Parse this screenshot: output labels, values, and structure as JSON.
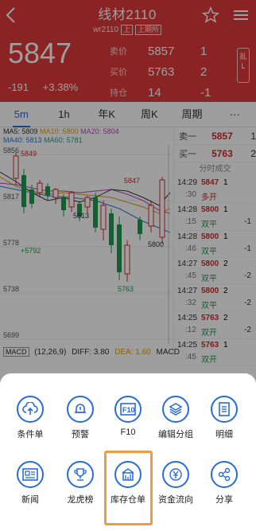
{
  "header": {
    "title": "线材2110",
    "code": "wr2110",
    "tag1": "上",
    "tag2": "上期所",
    "price": "5847",
    "change": "-191",
    "change_pct": "+3.38%",
    "quote": [
      {
        "label": "卖价",
        "value": "5857",
        "num": "1"
      },
      {
        "label": "买价",
        "value": "5763",
        "num": "2"
      },
      {
        "label": "持仓",
        "value": "14",
        "num": "-1"
      }
    ],
    "side_btn": "乱 L"
  },
  "tabs": [
    {
      "label": "5m",
      "active": true
    },
    {
      "label": "1h",
      "active": false
    },
    {
      "label": "年K",
      "active": false
    },
    {
      "label": "周K",
      "active": false
    },
    {
      "label": "周期",
      "active": false
    },
    {
      "label": "···",
      "active": false
    }
  ],
  "chart": {
    "ma_line1": {
      "ma5": "MA5: 5809",
      "ma10": "MA10: 5800",
      "ma20": "MA20: 5804"
    },
    "ma_line2": {
      "ma40": "MA40: 5813",
      "ma60": "MA60: 5781"
    },
    "y_labels": [
      "5856",
      "5817",
      "5778",
      "5738",
      "5699"
    ],
    "annotations": [
      "5849",
      "5813",
      "+5792",
      "5847",
      "5800",
      "5763"
    ]
  },
  "orderbook": {
    "ask_label": "卖一",
    "ask_price": "5857",
    "ask_num": "1",
    "bid_label": "买一",
    "bid_price": "5763",
    "bid_num": "2",
    "ticks_title": "分时成交",
    "ticks": [
      {
        "time": "14:29",
        "sec": ":30",
        "price": "5847",
        "action": "多开",
        "vol": "1",
        "delta": "",
        "pc": "red",
        "ac": "red"
      },
      {
        "time": "14:28",
        "sec": ":15",
        "price": "5800",
        "action": "双平",
        "vol": "1",
        "delta": "-1",
        "pc": "red",
        "ac": "green"
      },
      {
        "time": "14:28",
        "sec": ":46",
        "price": "5800",
        "action": "双平",
        "vol": "1",
        "delta": "-1",
        "pc": "red",
        "ac": "green"
      },
      {
        "time": "14:27",
        "sec": ":45",
        "price": "5800",
        "action": "双平",
        "vol": "2",
        "delta": "-2",
        "pc": "red",
        "ac": "green"
      },
      {
        "time": "14:27",
        "sec": ":32",
        "price": "5800",
        "action": "双平",
        "vol": "2",
        "delta": "-2",
        "pc": "red",
        "ac": "green"
      },
      {
        "time": "14:25",
        "sec": ":12",
        "price": "5763",
        "action": "双开",
        "vol": "2",
        "delta": "-2",
        "pc": "red",
        "ac": "green"
      },
      {
        "time": "14:25",
        "sec": ":45",
        "price": "5763",
        "action": "双开",
        "vol": "1",
        "delta": "",
        "pc": "red",
        "ac": "green"
      }
    ]
  },
  "macd": {
    "key": "MACD",
    "params": "(12,26,9)",
    "dif": "DIFF: 3.80",
    "dea": "DEA: 1.60",
    "macd": "MACD"
  },
  "sheet": {
    "row1": [
      {
        "label": "条件单",
        "icon": "cloud-upload-icon"
      },
      {
        "label": "预警",
        "icon": "bell-icon"
      },
      {
        "label": "F10",
        "icon": "f10-icon"
      },
      {
        "label": "编辑分组",
        "icon": "layers-icon"
      },
      {
        "label": "明细",
        "icon": "document-icon"
      }
    ],
    "row2": [
      {
        "label": "新闻",
        "icon": "news-icon"
      },
      {
        "label": "龙虎榜",
        "icon": "trophy-icon"
      },
      {
        "label": "库存仓单",
        "icon": "warehouse-icon"
      },
      {
        "label": "资金流向",
        "icon": "yen-icon"
      },
      {
        "label": "分享",
        "icon": "share-icon"
      }
    ]
  }
}
